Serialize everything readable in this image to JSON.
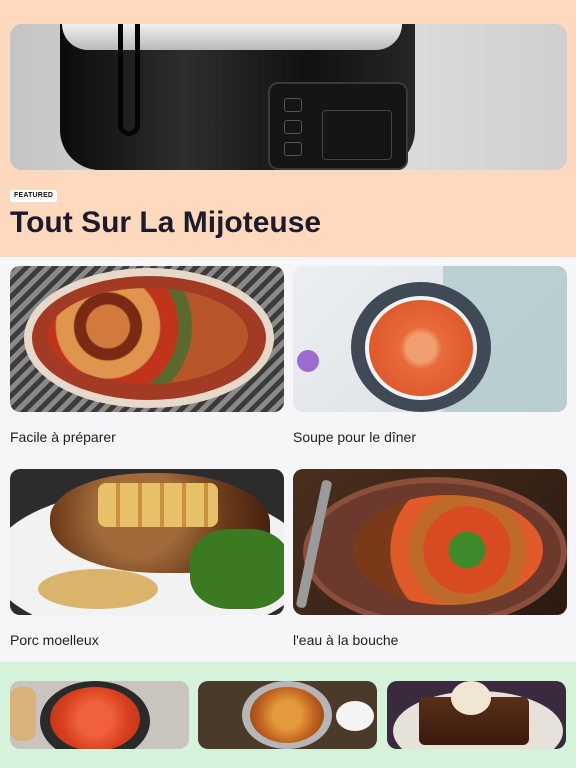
{
  "featured": {
    "badge": "FEATURED",
    "title": "Tout Sur La Mijoteuse",
    "image": "slow-cooker-photo"
  },
  "recipes": [
    {
      "label": "Facile à préparer",
      "image": "chicken-vegetable-casserole-photo"
    },
    {
      "label": "Soupe pour le dîner",
      "image": "tomato-soup-bowl-photo"
    },
    {
      "label": "Porc moelleux",
      "image": "pork-chop-apples-photo"
    },
    {
      "label": "l'eau à la bouche",
      "image": "stew-with-broccoli-photo"
    }
  ],
  "more": [
    {
      "image": "tomato-pan-photo"
    },
    {
      "image": "vegetable-stew-pot-photo"
    },
    {
      "image": "brownie-ice-cream-photo"
    }
  ],
  "colors": {
    "hero_background": "#ffd9bd",
    "bottom_background": "#d4f3da",
    "page_background": "#f6f6f8",
    "title_text": "#1b1b2b"
  }
}
